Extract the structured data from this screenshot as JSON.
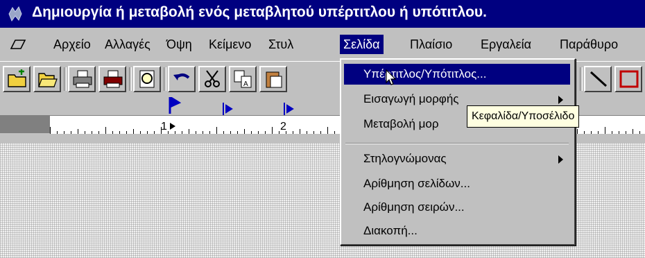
{
  "window": {
    "title": "Δημιουργία ή μεταβολή ενός μεταβλητού υπέρτιτλου ή υπότιτλου.",
    "app_icon": "app-icon"
  },
  "menubar": {
    "items": [
      {
        "label": "Αρχείο"
      },
      {
        "label": "Αλλαγές"
      },
      {
        "label": "Όψη"
      },
      {
        "label": "Κείμενο"
      },
      {
        "label": "Στυλ"
      },
      {
        "label": "Σελίδα",
        "active": true
      },
      {
        "label": "Πλαίσιο"
      },
      {
        "label": "Εργαλεία"
      },
      {
        "label": "Παράθυρο"
      }
    ]
  },
  "toolbar": {
    "buttons": [
      "new-folder-icon",
      "open-folder-icon",
      "print-icon",
      "print-preview-icon",
      "find-icon",
      "undo-icon",
      "cut-icon",
      "copy-icon",
      "paste-icon"
    ]
  },
  "ruler": {
    "numbers": [
      "1",
      "2"
    ]
  },
  "dropdown": {
    "items": [
      {
        "label": "Υπέρτιτλος/Υπότιτλος...",
        "active": true
      },
      {
        "label": "Εισαγωγή μορφής",
        "submenu": true
      },
      {
        "label": "Μεταβολή μορ"
      },
      {
        "label": "Στηλογνώμονας",
        "submenu": true
      },
      {
        "label": "Αρίθμηση σελίδων..."
      },
      {
        "label": "Αρίθμηση σειρών..."
      },
      {
        "label": "Διακοπή..."
      }
    ]
  },
  "tooltip": {
    "text": "Κεφαλίδα/Υποσέλιδο"
  },
  "colors": {
    "title_bar": "#000080",
    "face": "#c0c0c0",
    "highlight": "#000080",
    "tooltip_bg": "#ffffe1"
  }
}
